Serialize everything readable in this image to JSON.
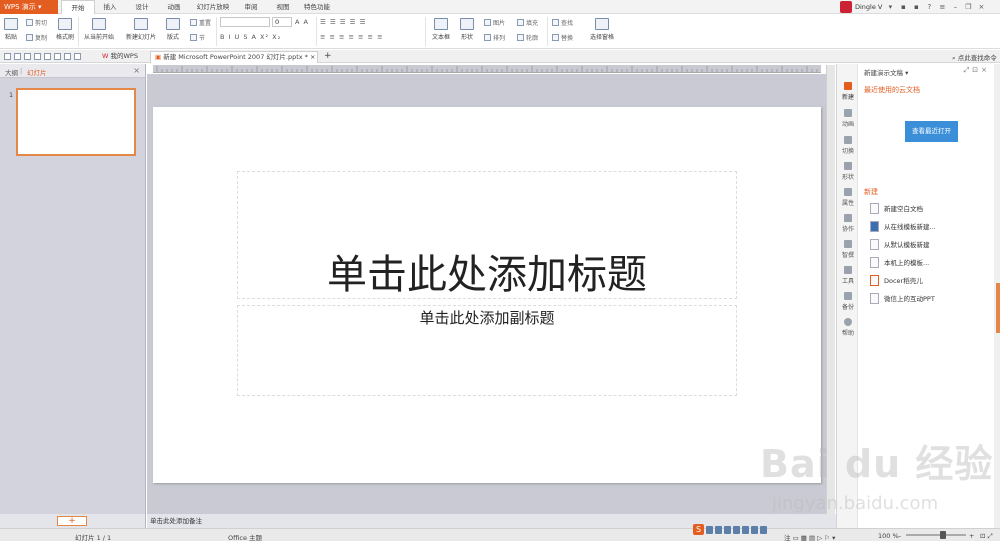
{
  "app": {
    "name": "WPS 演示"
  },
  "menu": {
    "tabs": [
      "开始",
      "插入",
      "设计",
      "动画",
      "幻灯片放映",
      "审阅",
      "视图",
      "特色功能"
    ],
    "active": "开始"
  },
  "user": {
    "name": "Dingle V"
  },
  "ribbon": {
    "paste": "粘贴",
    "cut": "剪切",
    "copy": "复制",
    "format_painter": "格式刷",
    "from_current": "从当前开始",
    "new_slide": "新建幻灯片",
    "reset": "重置",
    "layout": "版式",
    "section": "节",
    "font_size": "0",
    "font_style_buttons": "B I U S A  X² X₂",
    "textbox": "文本框",
    "shape": "形状",
    "picture": "图片",
    "fill": "填充",
    "arrange": "排列",
    "outline": "轮廓",
    "find": "查找",
    "replace": "替换",
    "select_pane": "选择窗格"
  },
  "doc_tabs": {
    "home": "我的WPS",
    "current": "新建 Microsoft PowerPoint 2007 幻灯片.pptx *",
    "add": "+"
  },
  "search_cmd": "点此查找命令",
  "left_panel": {
    "tab_outline": "大纲",
    "tab_slides": "幻灯片",
    "thumb_number": "1",
    "close": "×"
  },
  "slide": {
    "title": "单击此处添加标题",
    "subtitle": "单击此处添加副标题"
  },
  "notes_placeholder": "单击此处添加备注",
  "sidebar": {
    "items": [
      "新建",
      "动画",
      "切换",
      "形状",
      "属性",
      "协作",
      "智撰",
      "工具",
      "备份",
      "帮助"
    ]
  },
  "task_pane": {
    "title": "新建演示文稿 ▾",
    "recent_header": "最近使用的云文档",
    "open_recent_button": "查看最近打开",
    "new_header": "新建",
    "items": [
      "新建空白文档",
      "从在线模板新建...",
      "从默认模板新建",
      "本机上的模板...",
      "Docer稻壳儿",
      "微信上的互动PPT"
    ]
  },
  "status": {
    "slide_counter": "幻灯片 1 / 1",
    "theme": "Office 主题",
    "zoom": "100 %"
  },
  "watermark": {
    "logo": "Bai du 经验",
    "url": "jingyan.baidu.com"
  },
  "colors": {
    "accent": "#e35d21",
    "workspace": "#c9cad3",
    "button_blue": "#3b8fd9"
  }
}
